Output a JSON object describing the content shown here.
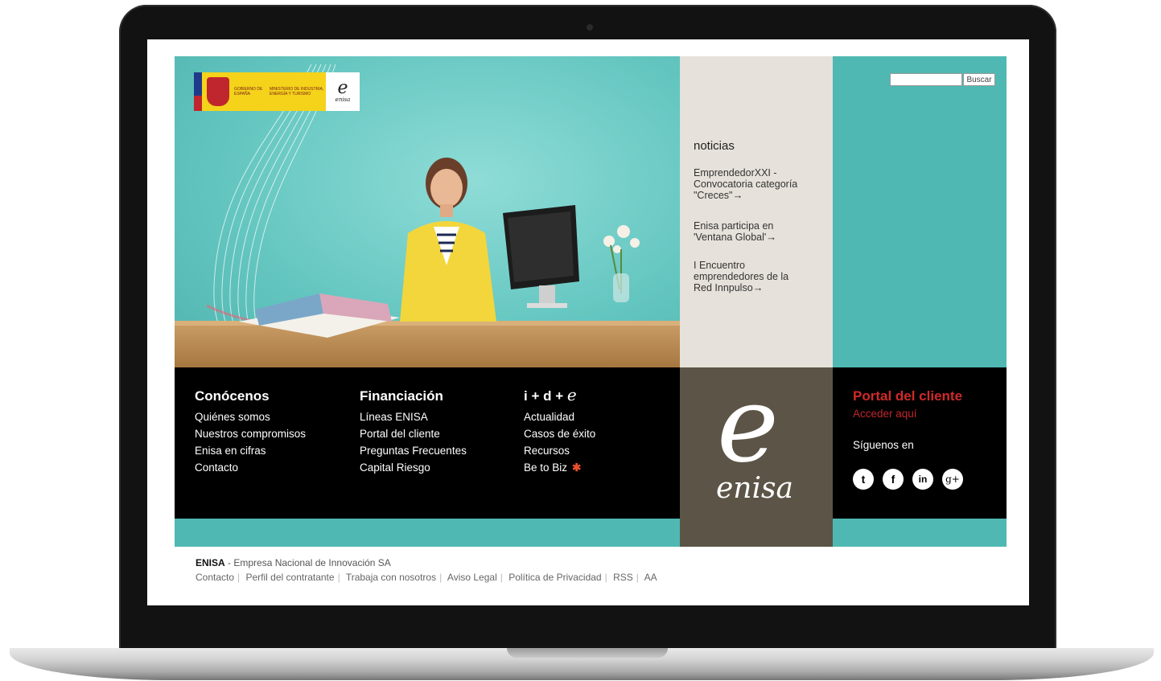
{
  "search": {
    "button_label": "Buscar",
    "placeholder": ""
  },
  "gov_logo": {
    "text1": "Gobierno de España",
    "text2": "Ministerio de Industria, Energía y Turismo",
    "mini_e": "e",
    "mini_word": "enisa"
  },
  "news": {
    "title": "noticias",
    "items": [
      {
        "line1": "EmprendedorXXI -",
        "line2": "Convocatoria categoría",
        "line3": "\"Creces\""
      },
      {
        "line1": "Enisa participa en",
        "line2": "'Ventana Global'"
      },
      {
        "line1": "I Encuentro",
        "line2": "emprendedores de la",
        "line3": "Red Innpulso"
      }
    ],
    "arrow": "→"
  },
  "nav": {
    "col1": {
      "title": "Conócenos",
      "links": [
        "Quiénes somos",
        "Nuestros compromisos",
        "Enisa en cifras",
        "Contacto"
      ]
    },
    "col2": {
      "title": "Financiación",
      "links": [
        "Líneas ENISA",
        "Portal del cliente",
        "Preguntas Frecuentes",
        "Capital Riesgo"
      ]
    },
    "col3": {
      "title_prefix": "i + d + ",
      "title_e": "e",
      "links": [
        "Actualidad",
        "Casos de éxito",
        "Recursos",
        "Be to Biz"
      ],
      "star": "✱"
    }
  },
  "logo": {
    "e": "e",
    "word": "enisa"
  },
  "client": {
    "title": "Portal del cliente",
    "link": "Acceder aquí",
    "follow": "Síguenos en",
    "social": [
      "t",
      "f",
      "in",
      "g+"
    ]
  },
  "footer": {
    "brand": "ENISA",
    "tagline": " - Empresa Nacional de Innovación SA",
    "links": [
      "Contacto",
      "Perfil del contratante",
      "Trabaja con nosotros",
      "Aviso Legal",
      "Política de Privacidad",
      "RSS",
      "AA"
    ]
  },
  "colors": {
    "teal": "#4fb8b2",
    "news_bg": "#e6e1da",
    "logo_bg": "#5c5547",
    "client_red": "#d02a2a",
    "star": "#e8502a"
  }
}
